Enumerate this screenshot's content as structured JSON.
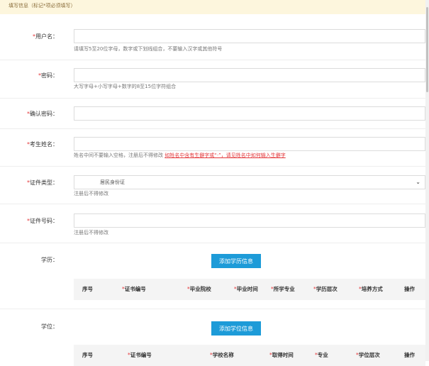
{
  "notice": "填写信息（标记*项必须填写）",
  "form": {
    "username": {
      "label": "*用户名：",
      "hint": "请填写5至20位字母，数字或下划线组合，不要输入汉字或其他符号"
    },
    "password": {
      "label": "*密码：",
      "hint": "大写字母+小写字母+数字的8至15位字符组合"
    },
    "confirm_password": {
      "label": "*确认密码："
    },
    "candidate_name": {
      "label": "*考生姓名：",
      "hint": "姓名中间不要输入空格，注册后不得修改",
      "link": "如姓名中含有生僻字或“·”，请见姓名中如何输入生僻字"
    },
    "id_type": {
      "label": "*证件类型：",
      "value": "居民身份证",
      "hint": "注册后不得修改"
    },
    "id_number": {
      "label": "*证件号码：",
      "hint": "注册后不得修改"
    }
  },
  "education": {
    "label": "学历：",
    "button": "添加学历信息",
    "columns": [
      "序号",
      "*证书编号",
      "*毕业院校",
      "*毕业时间",
      "*所学专业",
      "*学历层次",
      "*培养方式",
      "操作"
    ]
  },
  "degree": {
    "label": "学位：",
    "button": "添加学位信息",
    "columns": [
      "序号",
      "*证书编号",
      "*学校名称",
      "*取得时间",
      "*专业",
      "*学位层次",
      "操作"
    ]
  }
}
